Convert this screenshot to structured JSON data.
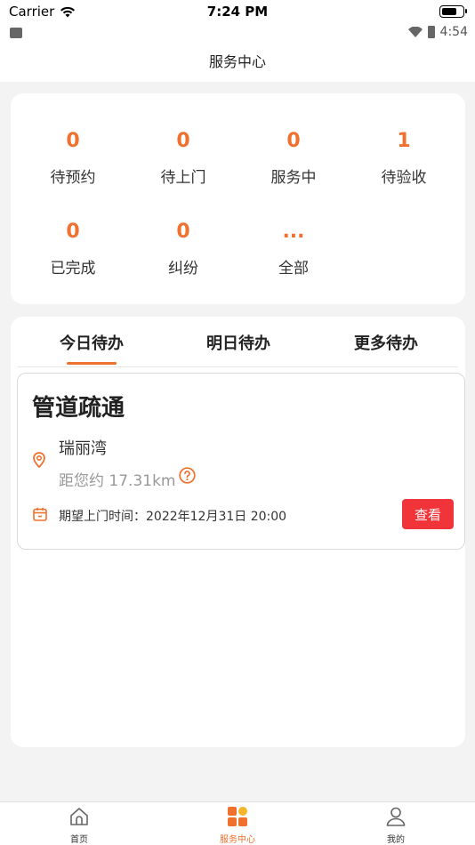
{
  "status_bar": {
    "carrier": "Carrier",
    "time": "7:24 PM",
    "android_time": "4:54"
  },
  "nav": {
    "title": "服务中心"
  },
  "stats": [
    {
      "count": "0",
      "label": "待预约"
    },
    {
      "count": "0",
      "label": "待上门"
    },
    {
      "count": "0",
      "label": "服务中"
    },
    {
      "count": "1",
      "label": "待验收"
    },
    {
      "count": "0",
      "label": "已完成"
    },
    {
      "count": "0",
      "label": "纠纷"
    },
    {
      "count": "...",
      "label": "全部"
    }
  ],
  "tabs": [
    {
      "label": "今日待办",
      "active": true
    },
    {
      "label": "明日待办",
      "active": false
    },
    {
      "label": "更多待办",
      "active": false
    }
  ],
  "task": {
    "title": "管道疏通",
    "location": "瑞丽湾",
    "distance": "距您约 17.31km",
    "expected_time": "期望上门时间：2022年12月31日 20:00",
    "view_label": "查看"
  },
  "tab_bar": [
    {
      "label": "首页",
      "icon": "home-icon",
      "active": false
    },
    {
      "label": "服务中心",
      "icon": "service-grid-icon",
      "active": true
    },
    {
      "label": "我的",
      "icon": "profile-icon",
      "active": false
    }
  ],
  "colors": {
    "accent": "#f0702e",
    "button_red": "#f0343a",
    "page_bg": "#f3f3f3"
  }
}
